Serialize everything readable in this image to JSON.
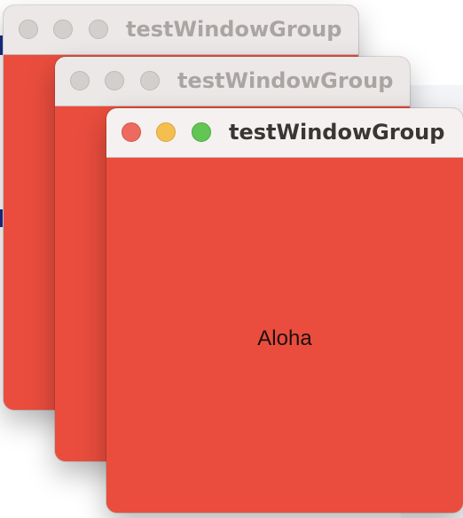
{
  "windows": [
    {
      "id": "back",
      "title": "testWindowGroup",
      "state": "inactive",
      "content_background": "#ea4d3d"
    },
    {
      "id": "middle",
      "title": "testWindowGroup",
      "state": "inactive",
      "content_background": "#ea4d3d"
    },
    {
      "id": "front",
      "title": "testWindowGroup",
      "state": "active",
      "content_background": "#ea4d3d",
      "body_text": "Aloha"
    }
  ],
  "traffic_lights": {
    "close_color": "#ed6a5e",
    "minimize_color": "#f5bf4f",
    "zoom_color": "#62c554",
    "inactive_color": "#d3cfcd"
  }
}
